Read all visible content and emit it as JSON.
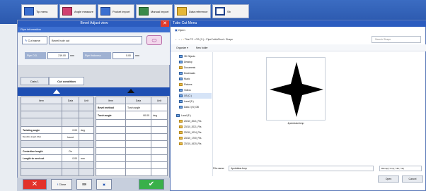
{
  "taskbar": {
    "buttons": [
      {
        "label": "Tip menu"
      },
      {
        "label": "Angle measure"
      },
      {
        "label": "Pocket import"
      },
      {
        "label": "Manual import"
      },
      {
        "label": "Data reference"
      },
      {
        "label": "Sb"
      }
    ]
  },
  "left_window": {
    "title": "Bevel Adjust view",
    "section_title": "Pipe information",
    "cut_name_label": "Cut name",
    "cut_name_value": "Bevel hole cut",
    "pipe_od_label": "Pipe O.D.",
    "pipe_od_value": "219.00",
    "pipe_od_unit": "mm",
    "pipe_thickness_label": "Pipe thickness",
    "pipe_thickness_value": "5.00",
    "pipe_thickness_unit": "mm",
    "tabs": [
      "Data 1",
      "Cut condition"
    ],
    "table_headers": [
      "Item",
      "Data",
      "Unit",
      "Item",
      "Data",
      "Unit"
    ],
    "right_rows": [
      {
        "item": "Bevel method",
        "data": "Torch angle",
        "unit": ""
      },
      {
        "item": "Torch angle",
        "data": "90.00",
        "unit": "deg"
      }
    ],
    "left_rows": [
      {
        "item": "Twisting angle",
        "data": "0.00",
        "unit": "deg"
      },
      {
        "item": "Bevel/line length offset",
        "data": "Insert",
        "unit": ""
      },
      {
        "item": "Centerline length",
        "data": "On",
        "unit": ""
      },
      {
        "item": "Length to next cut",
        "data": "0.00",
        "unit": "mm"
      }
    ],
    "bottom_buttons": {
      "close": "Close"
    }
  },
  "dialog": {
    "window_title": "Tube Cut Menu",
    "title": "Open",
    "address": "This PC  ›  OS (C:)  ›  PipeCuttinShort  ›  Shape",
    "search_placeholder": "Search Shape",
    "toolbar": {
      "organize": "Organize ▾",
      "new_folder": "New folder"
    },
    "nav_items": [
      "3D Objects",
      "Desktop",
      "Documents",
      "Downloads",
      "Music",
      "Pictures",
      "Videos",
      "OS (C:)",
      "Local (E:)",
      "Data 2 (N:) DB",
      "Local (E:)",
      "20210_2021_Fils",
      "20210_2021_Fils",
      "20210_1024_Fils",
      "20210_1700_Fils",
      "20210_1620_Fils"
    ],
    "file_name": "4pointstar.bmp",
    "file_name_label": "File name:",
    "file_name_value": "4pointstar.bmp",
    "filter_value": "Bitmap(*.bmp;*.dib;*.rle)",
    "open_button": "Open",
    "cancel_button": "Cancel"
  }
}
